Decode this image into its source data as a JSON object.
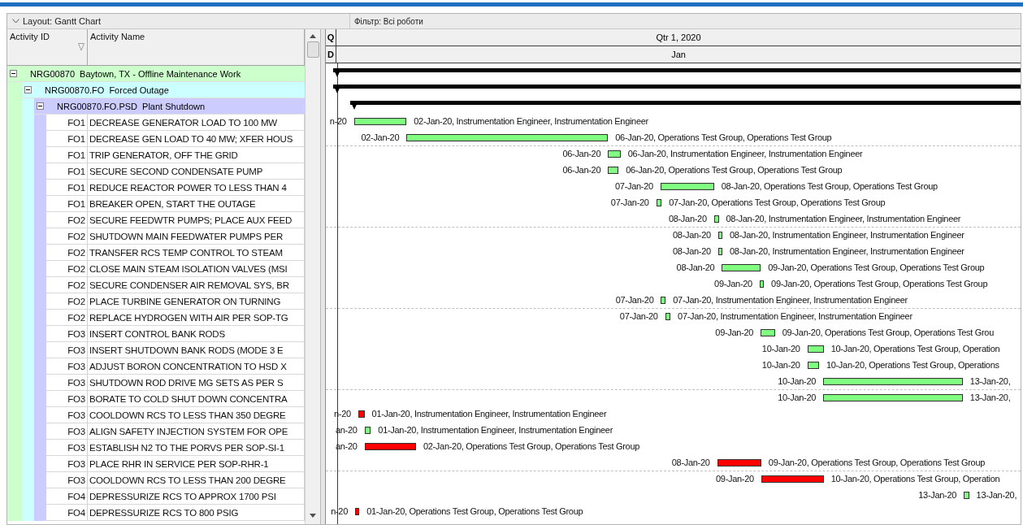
{
  "layout_label": "Layout: Gantt Chart",
  "filter_label": "Фільтр: Всі роботи",
  "columns": [
    "Activity ID",
    "Activity Name"
  ],
  "timescale": {
    "top_code": "Q",
    "top_label": "Qtr 1, 2020",
    "bottom_code": "D",
    "bottom_label": "Jan"
  },
  "rows": [
    {
      "kind": "wbs",
      "id": "NRG00870",
      "name": "Baytown, TX - Offline Maintenance Work",
      "expanded": true,
      "color": "#ccffcc",
      "children": [
        {
          "kind": "wbs",
          "id": "NRG00870.FO",
          "name": "Forced Outage",
          "expanded": true,
          "color": "#ccffff",
          "children": [
            {
              "kind": "wbs",
              "id": "NRG00870.FO.PSD",
              "name": "Plant Shutdown",
              "expanded": true,
              "color": "#ccccff",
              "children": [
                {
                  "kind": "activity",
                  "id": "FO1",
                  "name": "DECREASE GENERATOR LOAD TO 100 MW",
                  "start_label": "n-20",
                  "finish_label": "02-Jan-20, Instrumentation Engineer, Instrumentation Engineer",
                  "color": "#80ff80"
                },
                {
                  "kind": "activity",
                  "id": "FO1",
                  "name": "DECREASE GEN LOAD TO 40 MW; XFER HOUS",
                  "start_label": "02-Jan-20",
                  "finish_label": "06-Jan-20, Operations Test Group, Operations Test Group",
                  "color": "#80ff80"
                },
                {
                  "kind": "activity",
                  "id": "FO1",
                  "name": "TRIP GENERATOR,  OFF THE GRID",
                  "start_label": "06-Jan-20",
                  "finish_label": "06-Jan-20, Instrumentation Engineer, Instrumentation Engineer",
                  "color": "#80ff80"
                },
                {
                  "kind": "activity",
                  "id": "FO1",
                  "name": "SECURE SECOND CONDENSATE PUMP",
                  "start_label": "06-Jan-20",
                  "finish_label": "06-Jan-20, Operations Test Group, Operations Test Group",
                  "color": "#80ff80"
                },
                {
                  "kind": "activity",
                  "id": "FO1",
                  "name": "REDUCE REACTOR POWER TO LESS THAN 4",
                  "start_label": "07-Jan-20",
                  "finish_label": "08-Jan-20, Operations Test Group, Operations Test Group",
                  "color": "#80ff80"
                },
                {
                  "kind": "activity",
                  "id": "FO1",
                  "name": "BREAKER OPEN, START THE OUTAGE",
                  "start_label": "07-Jan-20",
                  "finish_label": "07-Jan-20, Operations Test Group, Operations Test Group",
                  "color": "#80ff80"
                },
                {
                  "kind": "activity",
                  "id": "FO2",
                  "name": "SECURE FEEDWTR PUMPS; PLACE AUX FEED",
                  "start_label": "08-Jan-20",
                  "finish_label": "08-Jan-20, Instrumentation Engineer, Instrumentation Engineer",
                  "color": "#80ff80"
                },
                {
                  "kind": "activity",
                  "id": "FO2",
                  "name": "SHUTDOWN MAIN FEEDWATER PUMPS PER",
                  "start_label": "08-Jan-20",
                  "finish_label": "08-Jan-20, Instrumentation Engineer, Instrumentation Engineer",
                  "color": "#80ff80"
                },
                {
                  "kind": "activity",
                  "id": "FO2",
                  "name": "TRANSFER RCS TEMP CONTROL TO STEAM",
                  "start_label": "08-Jan-20",
                  "finish_label": "08-Jan-20, Instrumentation Engineer, Instrumentation Engineer",
                  "color": "#80ff80"
                },
                {
                  "kind": "activity",
                  "id": "FO2",
                  "name": "CLOSE MAIN STEAM ISOLATION VALVES (MSI",
                  "start_label": "08-Jan-20",
                  "finish_label": "09-Jan-20, Operations Test Group, Operations Test Group",
                  "color": "#80ff80"
                },
                {
                  "kind": "activity",
                  "id": "FO2",
                  "name": "SECURE CONDENSER AIR REMOVAL SYS, BR",
                  "start_label": "09-Jan-20",
                  "finish_label": "09-Jan-20, Operations Test Group, Operations Test Group",
                  "color": "#80ff80"
                },
                {
                  "kind": "activity",
                  "id": "FO2",
                  "name": "PLACE TURBINE GENERATOR ON TURNING",
                  "start_label": "07-Jan-20",
                  "finish_label": "07-Jan-20, Instrumentation Engineer, Instrumentation Engineer",
                  "color": "#80ff80"
                },
                {
                  "kind": "activity",
                  "id": "FO2",
                  "name": "REPLACE HYDROGEN WITH AIR PER SOP-TG",
                  "start_label": "07-Jan-20",
                  "finish_label": "07-Jan-20, Instrumentation Engineer, Instrumentation Engineer",
                  "color": "#80ff80"
                },
                {
                  "kind": "activity",
                  "id": "FO3",
                  "name": "INSERT CONTROL BANK RODS",
                  "start_label": "09-Jan-20",
                  "finish_label": "09-Jan-20, Operations Test Group, Operations Test Grou",
                  "color": "#80ff80"
                },
                {
                  "kind": "activity",
                  "id": "FO3",
                  "name": "INSERT SHUTDOWN BANK RODS (MODE 3 E",
                  "start_label": "10-Jan-20",
                  "finish_label": "10-Jan-20, Operations Test Group, Operation",
                  "color": "#80ff80"
                },
                {
                  "kind": "activity",
                  "id": "FO3",
                  "name": "ADJUST BORON CONCENTRATION TO HSD X",
                  "start_label": "10-Jan-20",
                  "finish_label": "10-Jan-20, Operations Test Group, Operations",
                  "color": "#80ff80"
                },
                {
                  "kind": "activity",
                  "id": "FO3",
                  "name": "SHUTDOWN ROD DRIVE MG SETS AS PER S",
                  "start_label": "10-Jan-20",
                  "finish_label": "13-Jan-20,",
                  "color": "#80ff80"
                },
                {
                  "kind": "activity",
                  "id": "FO3",
                  "name": "BORATE TO COLD SHUT DOWN CONCENTRA",
                  "start_label": "10-Jan-20",
                  "finish_label": "13-Jan-20,",
                  "color": "#80ff80"
                },
                {
                  "kind": "activity",
                  "id": "FO3",
                  "name": "COOLDOWN RCS TO LESS THAN 350 DEGRE",
                  "start_label": "n-20",
                  "finish_label": "01-Jan-20, Instrumentation Engineer, Instrumentation Engineer",
                  "color": "#ff0000"
                },
                {
                  "kind": "activity",
                  "id": "FO3",
                  "name": "ALIGN SAFETY INJECTION SYSTEM FOR OPE",
                  "start_label": "an-20",
                  "finish_label": "01-Jan-20, Instrumentation Engineer, Instrumentation Engineer",
                  "color": "#80ff80"
                },
                {
                  "kind": "activity",
                  "id": "FO3",
                  "name": "ESTABLISH N2 TO THE PORVS PER SOP-SI-1",
                  "start_label": "an-20",
                  "finish_label": "02-Jan-20, Operations Test Group, Operations Test Group",
                  "color": "#ff0000"
                },
                {
                  "kind": "activity",
                  "id": "FO3",
                  "name": "PLACE RHR IN SERVICE PER SOP-RHR-1",
                  "start_label": "08-Jan-20",
                  "finish_label": "09-Jan-20, Operations Test Group, Operations Test Group",
                  "color": "#ff0000"
                },
                {
                  "kind": "activity",
                  "id": "FO3",
                  "name": "COOLDOWN RCS TO LESS THAN 200 DEGRE",
                  "start_label": "09-Jan-20",
                  "finish_label": "10-Jan-20, Operations Test Group, Operation",
                  "color": "#ff0000"
                },
                {
                  "kind": "activity",
                  "id": "FO4",
                  "name": "DEPRESSURIZE RCS TO APPROX 1700 PSI",
                  "start_label": "13-Jan-20",
                  "finish_label": "13-Jan-20,",
                  "color": "#80ff80"
                },
                {
                  "kind": "activity",
                  "id": "FO4",
                  "name": "DEPRESSURIZE RCS TO 800 PSIG",
                  "start_label": "n-20",
                  "finish_label": "01-Jan-20, Operations Test Group, Operations Test Group",
                  "color": "#ff0000"
                }
              ]
            }
          ]
        }
      ]
    }
  ]
}
